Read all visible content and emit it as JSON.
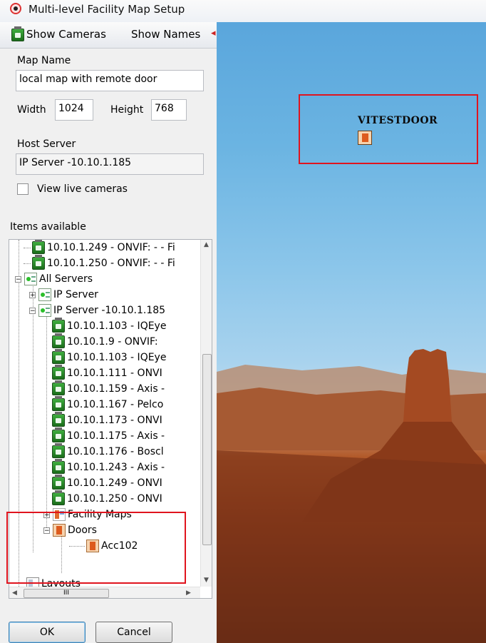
{
  "window": {
    "title": "Multi-level Facility Map Setup"
  },
  "toolbar": {
    "show_cameras": "Show Cameras",
    "show_names": "Show Names",
    "more_arrow": "◂"
  },
  "form": {
    "map_name_label": "Map Name",
    "map_name_value": "local map with remote door",
    "width_label": "Width",
    "width_value": "1024",
    "height_label": "Height",
    "height_value": "768",
    "host_server_label": "Host Server",
    "host_server_value": "IP Server -10.10.1.185",
    "view_live_label": "View live cameras",
    "view_live_checked": false
  },
  "tree": {
    "label": "Items available",
    "rows": [
      {
        "text": "10.10.1.249 - ONVIF:  - - Fi",
        "icon": "camera-icon"
      },
      {
        "text": "10.10.1.250 - ONVIF:  - - Fi",
        "icon": "camera-icon"
      },
      {
        "text": "All Servers",
        "icon": "server-icon"
      },
      {
        "text": "IP Server",
        "icon": "server-icon"
      },
      {
        "text": "IP Server -10.10.1.185",
        "icon": "server-icon"
      },
      {
        "text": "10.10.1.103 - IQEye",
        "icon": "camera-icon"
      },
      {
        "text": "10.10.1.9 - ONVIF:",
        "icon": "camera-icon"
      },
      {
        "text": "10.10.1.103 - IQEye",
        "icon": "camera-icon"
      },
      {
        "text": "10.10.1.111 - ONVI",
        "icon": "camera-icon"
      },
      {
        "text": "10.10.1.159 - Axis -",
        "icon": "camera-icon"
      },
      {
        "text": "10.10.1.167 - Pelco",
        "icon": "camera-icon"
      },
      {
        "text": "10.10.1.173 - ONVI",
        "icon": "camera-icon"
      },
      {
        "text": "10.10.1.175 - Axis -",
        "icon": "camera-icon"
      },
      {
        "text": "10.10.1.176 - Boscl",
        "icon": "camera-icon"
      },
      {
        "text": "10.10.1.243 - Axis -",
        "icon": "camera-icon"
      },
      {
        "text": "10.10.1.249 - ONVI",
        "icon": "camera-icon"
      },
      {
        "text": "10.10.1.250 - ONVI",
        "icon": "camera-icon"
      },
      {
        "text": "Facility Maps",
        "icon": "facility-map-icon"
      },
      {
        "text": "Doors",
        "icon": "door-icon"
      },
      {
        "text": "Acc102",
        "icon": "door-icon"
      },
      {
        "text": "Layouts",
        "icon": "layout-icon"
      }
    ],
    "expanders": {
      "all_servers": "−",
      "ip_server": "+",
      "ip_server_185": "−",
      "facility_maps": "+",
      "doors": "−"
    },
    "hscroll_thumb": "III"
  },
  "buttons": {
    "ok": "OK",
    "cancel": "Cancel"
  },
  "map": {
    "door_label": "VITESTDOOR"
  },
  "colors": {
    "highlight_box": "#e0141e",
    "camera_green": "#2e8b2e",
    "door_orange": "#dd5b1e"
  }
}
